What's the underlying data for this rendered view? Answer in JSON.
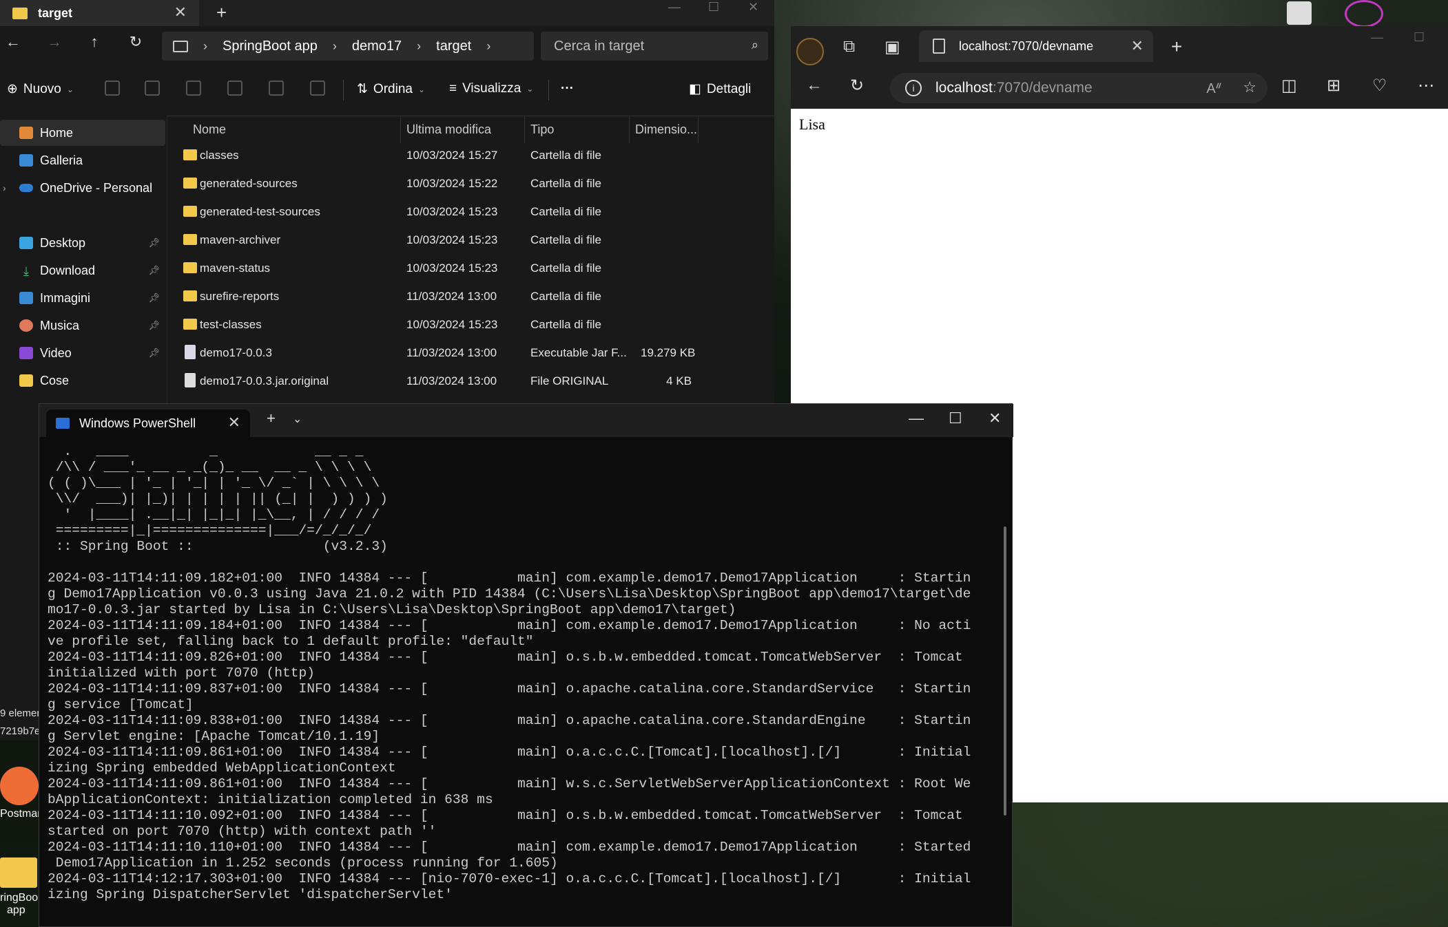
{
  "explorer": {
    "tab_title": "target",
    "breadcrumb": [
      "SpringBoot app",
      "demo17",
      "target"
    ],
    "search_placeholder": "Cerca in target",
    "toolbar": {
      "new": "Nuovo",
      "sort": "Ordina",
      "view": "Visualizza",
      "more": "···",
      "details": "Dettagli"
    },
    "nav": [
      {
        "label": "Home",
        "icon": "home-icon"
      },
      {
        "label": "Galleria",
        "icon": "gallery-icon"
      },
      {
        "label": "OneDrive - Personal",
        "icon": "onedrive-icon"
      },
      {
        "label": "Desktop",
        "icon": "desktop-icon"
      },
      {
        "label": "Download",
        "icon": "download-icon"
      },
      {
        "label": "Immagini",
        "icon": "pictures-icon"
      },
      {
        "label": "Musica",
        "icon": "music-icon"
      },
      {
        "label": "Video",
        "icon": "video-icon"
      },
      {
        "label": "Cose",
        "icon": "folder-icon"
      }
    ],
    "columns": [
      "Nome",
      "Ultima modifica",
      "Tipo",
      "Dimensio..."
    ],
    "files": [
      {
        "name": "classes",
        "modified": "10/03/2024 15:27",
        "type": "Cartella di file",
        "size": ""
      },
      {
        "name": "generated-sources",
        "modified": "10/03/2024 15:22",
        "type": "Cartella di file",
        "size": ""
      },
      {
        "name": "generated-test-sources",
        "modified": "10/03/2024 15:23",
        "type": "Cartella di file",
        "size": ""
      },
      {
        "name": "maven-archiver",
        "modified": "10/03/2024 15:23",
        "type": "Cartella di file",
        "size": ""
      },
      {
        "name": "maven-status",
        "modified": "10/03/2024 15:23",
        "type": "Cartella di file",
        "size": ""
      },
      {
        "name": "surefire-reports",
        "modified": "11/03/2024 13:00",
        "type": "Cartella di file",
        "size": ""
      },
      {
        "name": "test-classes",
        "modified": "10/03/2024 15:23",
        "type": "Cartella di file",
        "size": ""
      },
      {
        "name": "demo17-0.0.3",
        "modified": "11/03/2024 13:00",
        "type": "Executable Jar F...",
        "size": "19.279 KB"
      },
      {
        "name": "demo17-0.0.3.jar.original",
        "modified": "11/03/2024 13:00",
        "type": "File ORIGINAL",
        "size": "4 KB"
      }
    ],
    "status_items": "9 elemen",
    "status_hash": "7219b7e"
  },
  "browser": {
    "tab_title": "localhost:7070/devname",
    "url_host": "localhost",
    "url_rest": ":7070/devname",
    "page_text": "Lisa"
  },
  "terminal": {
    "tab_title": "Windows PowerShell",
    "output": "  .   ____          _            __ _ _\n /\\\\ / ___'_ __ _ _(_)_ __  __ _ \\ \\ \\ \\\n( ( )\\___ | '_ | '_| | '_ \\/ _` | \\ \\ \\ \\\n \\\\/  ___)| |_)| | | | | || (_| |  ) ) ) )\n  '  |____| .__|_| |_|_| |_\\__, | / / / /\n =========|_|==============|___/=/_/_/_/\n :: Spring Boot ::                (v3.2.3)\n\n2024-03-11T14:11:09.182+01:00  INFO 14384 --- [           main] com.example.demo17.Demo17Application     : Startin\ng Demo17Application v0.0.3 using Java 21.0.2 with PID 14384 (C:\\Users\\Lisa\\Desktop\\SpringBoot app\\demo17\\target\\de\nmo17-0.0.3.jar started by Lisa in C:\\Users\\Lisa\\Desktop\\SpringBoot app\\demo17\\target)\n2024-03-11T14:11:09.184+01:00  INFO 14384 --- [           main] com.example.demo17.Demo17Application     : No acti\nve profile set, falling back to 1 default profile: \"default\"\n2024-03-11T14:11:09.826+01:00  INFO 14384 --- [           main] o.s.b.w.embedded.tomcat.TomcatWebServer  : Tomcat\ninitialized with port 7070 (http)\n2024-03-11T14:11:09.837+01:00  INFO 14384 --- [           main] o.apache.catalina.core.StandardService   : Startin\ng service [Tomcat]\n2024-03-11T14:11:09.838+01:00  INFO 14384 --- [           main] o.apache.catalina.core.StandardEngine    : Startin\ng Servlet engine: [Apache Tomcat/10.1.19]\n2024-03-11T14:11:09.861+01:00  INFO 14384 --- [           main] o.a.c.c.C.[Tomcat].[localhost].[/]       : Initial\nizing Spring embedded WebApplicationContext\n2024-03-11T14:11:09.861+01:00  INFO 14384 --- [           main] w.s.c.ServletWebServerApplicationContext : Root We\nbApplicationContext: initialization completed in 638 ms\n2024-03-11T14:11:10.092+01:00  INFO 14384 --- [           main] o.s.b.w.embedded.tomcat.TomcatWebServer  : Tomcat\nstarted on port 7070 (http) with context path ''\n2024-03-11T14:11:10.110+01:00  INFO 14384 --- [           main] com.example.demo17.Demo17Application     : Started\n Demo17Application in 1.252 seconds (process running for 1.605)\n2024-03-11T14:12:17.303+01:00  INFO 14384 --- [nio-7070-exec-1] o.a.c.c.C.[Tomcat].[localhost].[/]       : Initial\nizing Spring DispatcherServlet 'dispatcherServlet'"
  },
  "desktop": {
    "icon1": "Postman",
    "icon2_line1": "ringBoo",
    "icon2_line2": "app"
  }
}
